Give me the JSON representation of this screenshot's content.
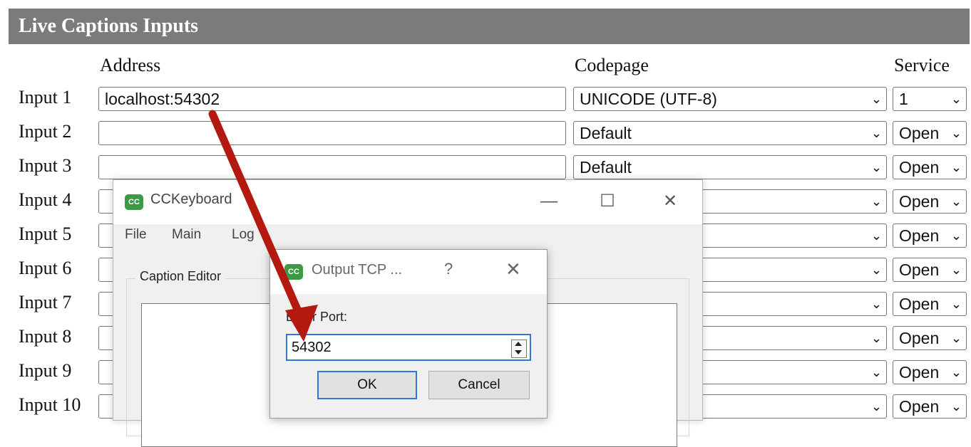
{
  "panel": {
    "title": "Live Captions Inputs"
  },
  "columns": {
    "address": "Address",
    "codepage": "Codepage",
    "service": "Service"
  },
  "inputs": [
    {
      "label": "Input 1",
      "address": "localhost:54302",
      "codepage": "UNICODE (UTF-8)",
      "service": "1"
    },
    {
      "label": "Input 2",
      "address": "",
      "codepage": "Default",
      "service": "Open"
    },
    {
      "label": "Input 3",
      "address": "",
      "codepage": "Default",
      "service": "Open"
    },
    {
      "label": "Input 4",
      "address": "",
      "codepage": "",
      "service": "Open"
    },
    {
      "label": "Input 5",
      "address": "",
      "codepage": "",
      "service": "Open"
    },
    {
      "label": "Input 6",
      "address": "",
      "codepage": "",
      "service": "Open"
    },
    {
      "label": "Input 7",
      "address": "",
      "codepage": "",
      "service": "Open"
    },
    {
      "label": "Input 8",
      "address": "",
      "codepage": "",
      "service": "Open"
    },
    {
      "label": "Input 9",
      "address": "",
      "codepage": "",
      "service": "Open"
    },
    {
      "label": "Input 10",
      "address": "",
      "codepage": "",
      "service": "Open"
    }
  ],
  "cckeyboard": {
    "title": "CCKeyboard",
    "icon_text": "CC",
    "controls": {
      "minimize": "—",
      "maximize": "☐",
      "close": "✕"
    },
    "menu": [
      "File",
      "Main",
      "Log"
    ],
    "caption_editor_label": "Caption Editor"
  },
  "tcp_dialog": {
    "title": "Output TCP ...",
    "help": "?",
    "close": "✕",
    "prompt": "Enter Port:",
    "port_value": "54302",
    "ok_label": "OK",
    "cancel_label": "Cancel"
  },
  "annotation": {
    "arrow_color": "#b3190f"
  }
}
